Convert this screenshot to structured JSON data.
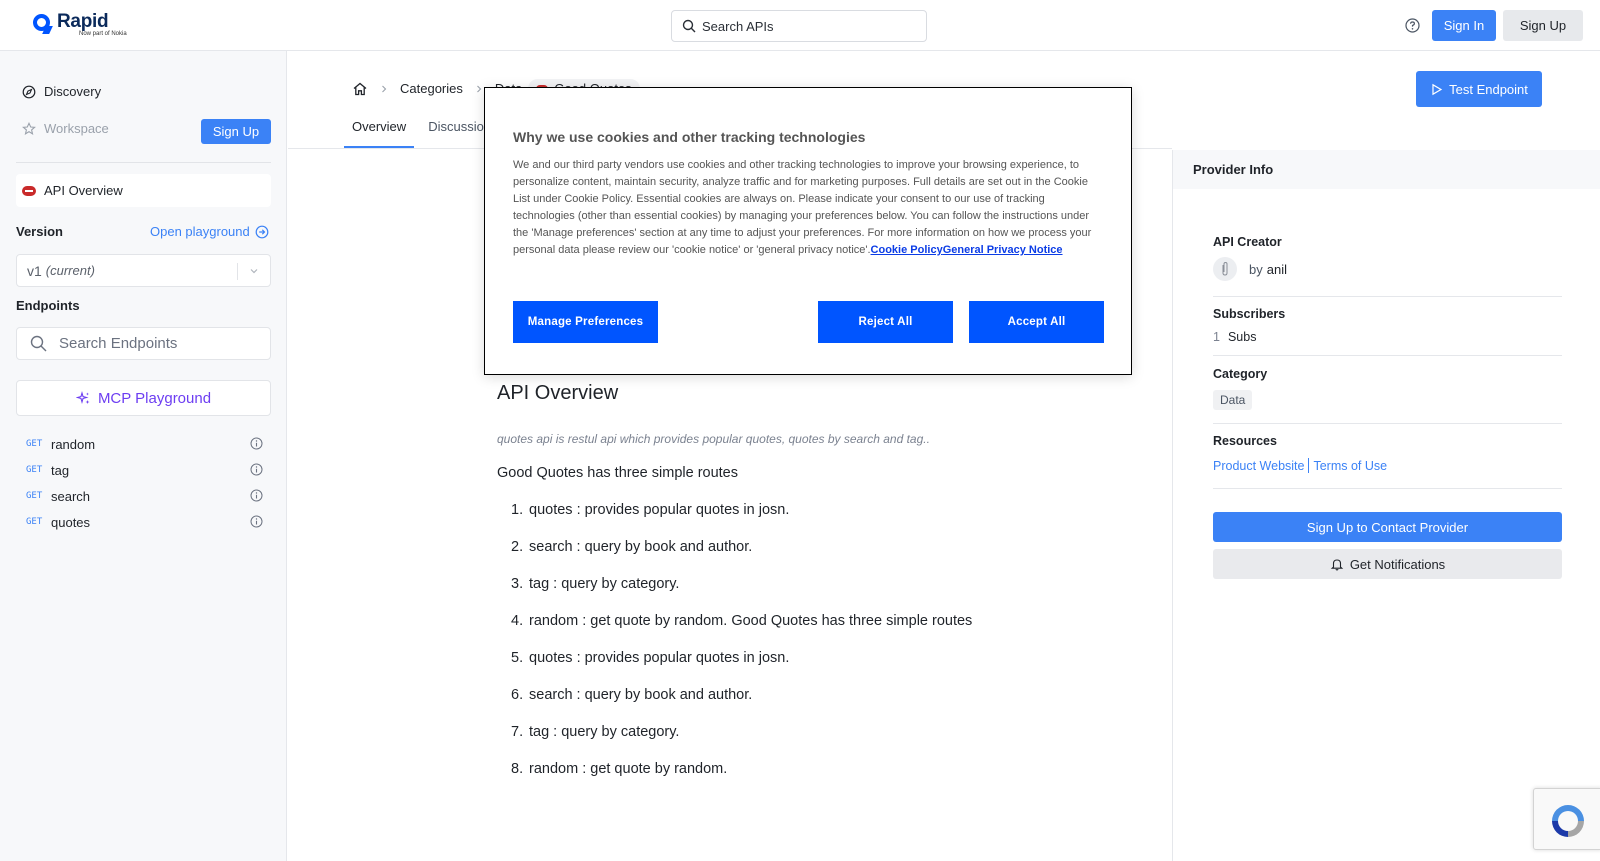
{
  "topbar": {
    "logo_text": "Rapid",
    "logo_sub": "Now part of Nokia",
    "search_placeholder": "Search APIs",
    "signin_label": "Sign In",
    "signup_label": "Sign Up"
  },
  "sidebar": {
    "discovery_label": "Discovery",
    "workspace_label": "Workspace",
    "signup_label": "Sign Up",
    "api_overview_label": "API Overview",
    "version_label": "Version",
    "open_playground_label": "Open playground",
    "version_value": "v1",
    "version_current": "(current)",
    "endpoints_label": "Endpoints",
    "search_endpoints_placeholder": "Search Endpoints",
    "mcp_label": "MCP Playground",
    "endpoints": [
      {
        "method": "GET",
        "name": "random"
      },
      {
        "method": "GET",
        "name": "tag"
      },
      {
        "method": "GET",
        "name": "search"
      },
      {
        "method": "GET",
        "name": "quotes"
      }
    ]
  },
  "main": {
    "breadcrumb": [
      "Categories",
      "Data",
      "Good Quotes"
    ],
    "test_endpoint_label": "Test Endpoint",
    "tabs": [
      {
        "label": "Overview",
        "active": true
      },
      {
        "label": "Discussions",
        "active": false
      }
    ],
    "overview_title": "API Overview",
    "description": "quotes api is restul api which provides popular quotes, quotes by search and tag..",
    "intro": "Good Quotes has three simple routes",
    "routes": [
      "quotes : provides popular quotes in josn.",
      "search : query by book and author.",
      "tag : query by category.",
      "random : get quote by random. Good Quotes has three simple routes",
      "quotes : provides popular quotes in josn.",
      "search : query by book and author.",
      "tag : query by category.",
      "random : get quote by random."
    ]
  },
  "provider": {
    "header": "Provider Info",
    "creator_label": "API Creator",
    "creator_by": "by",
    "creator_name": "anil",
    "subscribers_label": "Subscribers",
    "subscribers_count": "1",
    "subscribers_unit": "Subs",
    "category_label": "Category",
    "category_value": "Data",
    "resources_label": "Resources",
    "product_website": "Product Website",
    "terms_of_use": "Terms of Use",
    "contact_label": "Sign Up to Contact Provider",
    "notifications_label": "Get Notifications"
  },
  "cookie_modal": {
    "title": "Why we use cookies and other tracking technologies",
    "body": "We and our third party vendors use cookies and other tracking technologies to improve your browsing experience, to personalize content, maintain security, analyze traffic and for marketing purposes. Full details are set out in the Cookie List under Cookie Policy. Essential cookies are always on. Please indicate your consent to our use of tracking technologies (other than essential cookies) by managing your preferences below. You can follow the instructions under the 'Manage preferences' section at any time to adjust your preferences. For more information on how we process your personal data please review our 'cookie notice' or 'general privacy notice'.",
    "cookie_policy_link": "Cookie Policy",
    "privacy_notice_link": "General Privacy Notice",
    "manage_label": "Manage Preferences",
    "reject_label": "Reject All",
    "accept_label": "Accept All"
  },
  "colors": {
    "accent": "#3b82f6",
    "cookie_button": "#0055ff",
    "mcp_purple": "#6d3ef2",
    "api_badge_red": "#c92a2a"
  }
}
